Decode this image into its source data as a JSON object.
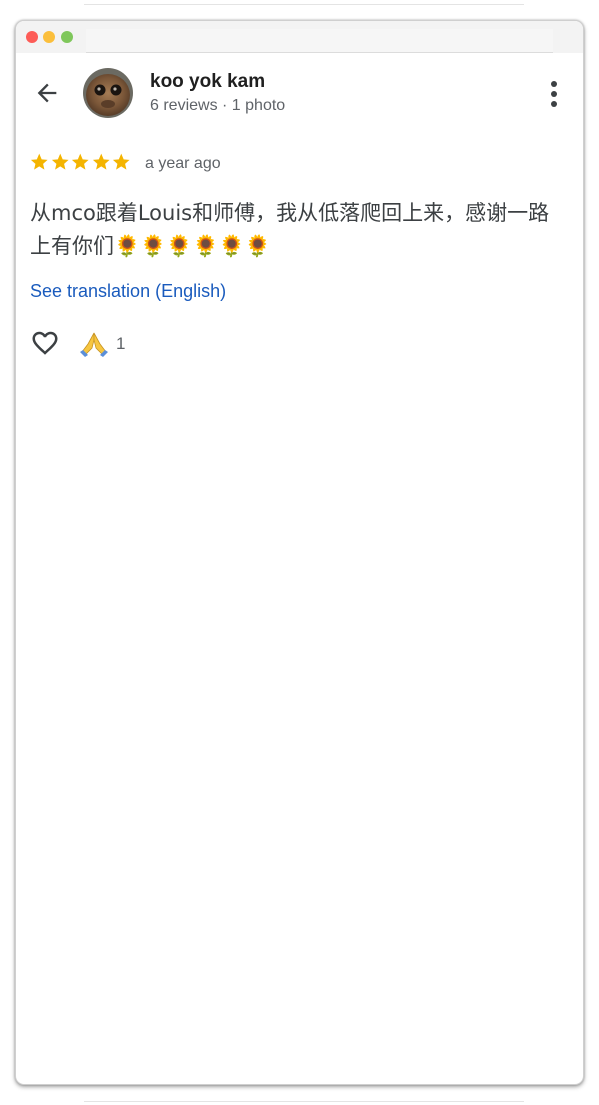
{
  "header": {
    "user_name": "koo yok kam",
    "user_meta": "6 reviews · 1 photo",
    "icons": {
      "back": "back-arrow-icon",
      "avatar": "profile-photo",
      "more": "more-vert-icon"
    }
  },
  "review": {
    "rating": 5,
    "rating_max": 5,
    "date": "a year ago",
    "text": "从mco跟着Louis和师傅，我从低落爬回上来，感谢一路上有你们",
    "emojis": "🌻🌻🌻🌻🌻🌻",
    "emoji_icon": "sunflower-icon",
    "translate_link": "See translation (English)"
  },
  "reactions": {
    "like_icon": "heart-outline-icon",
    "reaction_icon": "folded-hands-icon",
    "count": "1"
  },
  "colors": {
    "star": "#f4b400",
    "link": "#1a5bbd",
    "text": "#3c4043",
    "meta": "#5f6368",
    "title": "#1f1f1f"
  }
}
